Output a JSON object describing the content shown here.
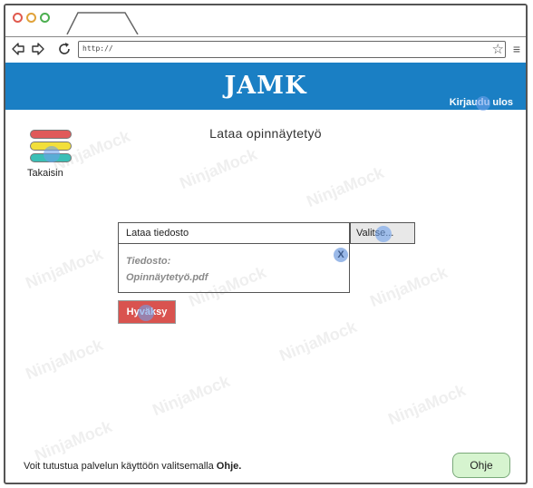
{
  "browser": {
    "url": "http://",
    "back_icon": "arrow-left-icon",
    "forward_icon": "arrow-right-icon",
    "reload_icon": "reload-icon",
    "star_icon": "star-icon",
    "menu_icon": "menu-icon"
  },
  "header": {
    "logo": "JAMK",
    "logout_label": "Kirjaudu ulos",
    "color": "#1a7fc4"
  },
  "page": {
    "title": "Lataa opinnäytetyö"
  },
  "back": {
    "label": "Takaisin",
    "icon": "colored-bars-menu-icon",
    "bar_colors": [
      "#e05a5a",
      "#f2df3a",
      "#3bbfb6"
    ]
  },
  "upload": {
    "label": "Lataa tiedosto",
    "select_button": "Valitse...",
    "file_line1": "Tiedosto:",
    "file_line2": "Opinnäytetyö.pdf",
    "clear_glyph": "X"
  },
  "accept_button": {
    "label": "Hyväksy",
    "color": "#d9534f"
  },
  "footer": {
    "hint_text": "Voit tutustua palvelun käyttöön valitsemalla ",
    "hint_bold": "Ohje.",
    "help_button": "Ohje"
  },
  "watermark": {
    "text": "NinjaMock"
  }
}
